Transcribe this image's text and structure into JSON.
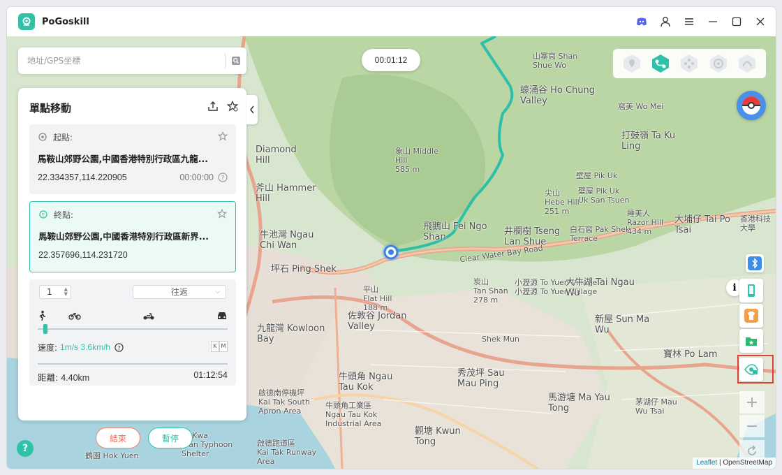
{
  "app": {
    "title": "PoGoskill"
  },
  "search": {
    "placeholder": "地址/GPS坐標"
  },
  "timer": "00:01:12",
  "panel": {
    "title": "單點移動",
    "start": {
      "label": "起點:",
      "address": "馬鞍山郊野公園,中國香港特別行政區九龍...",
      "coords": "22.334357,114.220905",
      "time": "00:00:00"
    },
    "end": {
      "label": "終點:",
      "address": "馬鞍山郊野公園,中國香港特別行政區新界...",
      "coords": "22.357696,114.231720"
    },
    "repeat_count": "1",
    "route_mode": "往返",
    "speed_label": "速度:",
    "speed_value": "1m/s 3.6km/h",
    "unit_k": "K",
    "unit_m": "M",
    "distance_label": "距離:",
    "distance_value": "4.40km",
    "eta": "01:12:54",
    "speed_fraction": 0.03
  },
  "buttons": {
    "stop": "結束",
    "pause": "暫停"
  },
  "map_labels": [
    {
      "text": "山寨窩 Shan\nShue Wo"
    },
    {
      "text": "蠔涌谷 Ho Chung\nValley"
    },
    {
      "text": "窩美 Wo Mei"
    },
    {
      "text": "打鼓嶺 Ta Ku\nLing"
    },
    {
      "text": "壁屋 Pik Uk"
    },
    {
      "text": "壁屋 Pik Uk\nUk San Tsuen"
    },
    {
      "text": "尖山\nHebe Hill\n251 m"
    },
    {
      "text": "象山 Middle\nHill\n585 m"
    },
    {
      "text": "Diamond\nHill"
    },
    {
      "text": "斧山 Hammer\nHill"
    },
    {
      "text": "飛鵝山 Fei Ngo\nShan"
    },
    {
      "text": "井欄樹 Tseng\nLan Shue"
    },
    {
      "text": "白石窩 Pak Shek\nTerrace"
    },
    {
      "text": "大埔仔 Tai Po\nTsai"
    },
    {
      "text": "睡美人\nRazor Hill\n434 m"
    },
    {
      "text": "牛池灣 Ngau\nChi Wan"
    },
    {
      "text": "坪石 Ping Shek"
    },
    {
      "text": "平山\nFlat Hill\n188 m"
    },
    {
      "text": "佐敦谷 Jordan\nValley"
    },
    {
      "text": "炭山\nTan Shan\n278 m"
    },
    {
      "text": "小瀝源 To Yuen Village\n小瀝源 To Yuen Village"
    },
    {
      "text": "大牛湖 Tai Ngau\nWu"
    },
    {
      "text": "新屋 Sun Ma\nWu"
    },
    {
      "text": "九龍灣 Kowloon\nBay"
    },
    {
      "text": "秀茂坪 Sau\nMau Ping"
    },
    {
      "text": "牛頭角 Ngau\nTau Kok"
    },
    {
      "text": "寶林 Po Lam"
    },
    {
      "text": "馬游塘 Ma Yau\nTong"
    },
    {
      "text": "茅湖仔 Mau\nWu Tsai"
    },
    {
      "text": "啟德南停機坪\nKai Tak South\nApron Area"
    },
    {
      "text": "牛頭角工業區\nNgau Tau Kok\nIndustrial Area"
    },
    {
      "text": "觀塘 Kwun\nTong"
    },
    {
      "text": "啟德跑道區\nKai Tak Runway\nArea"
    },
    {
      "text": "鶴園 Hok Yuen"
    },
    {
      "text": "To Kwa\nWan Typhoon\nShelter"
    },
    {
      "text": "Shek Mun"
    },
    {
      "text": "香港科技\n大學"
    },
    {
      "text": "Clear Water Bay Road"
    },
    {
      "text": "蠔涌谷 Ho Chung\nValley"
    }
  ],
  "attribution": {
    "leaflet": "Leaflet",
    "osm": "| OpenStreetMap"
  }
}
